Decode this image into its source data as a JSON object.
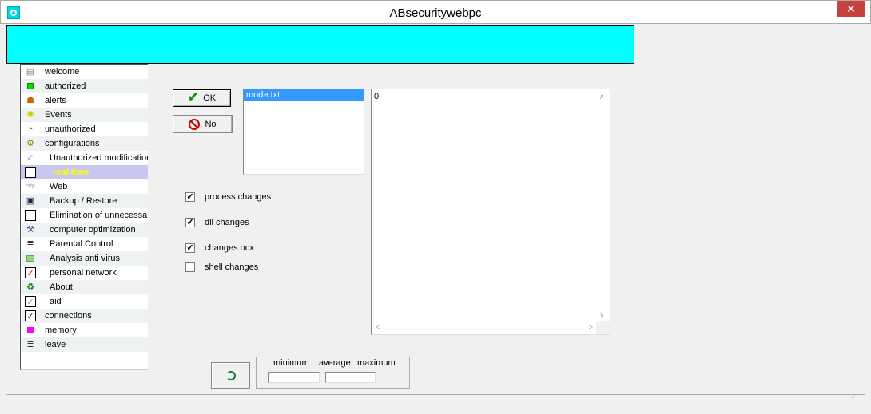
{
  "window": {
    "title": "ABsecuritywebpc",
    "close_glyph": "✕",
    "accent": "#00ffff"
  },
  "sidebar": {
    "items": [
      {
        "label": "welcome",
        "icon": "document-icon",
        "glyph": "▤"
      },
      {
        "label": "authorized",
        "icon": "green-square-icon",
        "glyph": ""
      },
      {
        "label": "alerts",
        "icon": "person-icon",
        "glyph": "☗"
      },
      {
        "label": "Events",
        "icon": "lightbulb-icon",
        "glyph": "✺"
      },
      {
        "label": "unauthorized",
        "icon": "clock-icon",
        "glyph": "◔"
      },
      {
        "label": "configurations",
        "icon": "tools-icon",
        "glyph": "⚙"
      },
      {
        "label": "Unauthorized modifications",
        "icon": "checkmark-icon",
        "glyph": "✓"
      },
      {
        "label": "real time",
        "icon": "box-icon",
        "glyph": ""
      },
      {
        "label": "Web",
        "icon": "http-icon",
        "glyph": "http"
      },
      {
        "label": "Backup / Restore",
        "icon": "backup-icon",
        "glyph": "▣"
      },
      {
        "label": "Elimination of unnecessary files",
        "icon": "box-icon",
        "glyph": ""
      },
      {
        "label": "computer optimization",
        "icon": "wrench-icon",
        "glyph": "⚒"
      },
      {
        "label": "Parental Control",
        "icon": "list-icon",
        "glyph": "≣"
      },
      {
        "label": "Analysis anti virus",
        "icon": "light-green-square-icon",
        "glyph": ""
      },
      {
        "label": "personal network",
        "icon": "red-check-icon",
        "glyph": "✓"
      },
      {
        "label": "About",
        "icon": "recycle-icon",
        "glyph": "♻"
      },
      {
        "label": "aid",
        "icon": "box-check-icon",
        "glyph": "✓"
      },
      {
        "label": "connections",
        "icon": "checkbox-icon",
        "glyph": "✓"
      },
      {
        "label": "memory",
        "icon": "magenta-square-icon",
        "glyph": ""
      },
      {
        "label": "leave",
        "icon": "list-icon",
        "glyph": "≣"
      }
    ]
  },
  "main": {
    "ok_label": "OK",
    "no_label": "No",
    "ok_glyph": "✔",
    "file_list": [
      "mode.txt"
    ],
    "text_content": "0",
    "checkboxes": [
      {
        "label": "process changes",
        "checked": true,
        "mark": "✓"
      },
      {
        "label": "dll changes",
        "checked": true,
        "mark": "✓"
      },
      {
        "label": "changes ocx",
        "checked": true,
        "mark": "✓"
      },
      {
        "label": "shell changes",
        "checked": false,
        "mark": ""
      }
    ]
  },
  "stats": {
    "minimum": "minimum",
    "average": "average",
    "maximum": "maximum"
  },
  "scroll": {
    "up": "∧",
    "down": "∨",
    "left": "<",
    "right": ">"
  }
}
